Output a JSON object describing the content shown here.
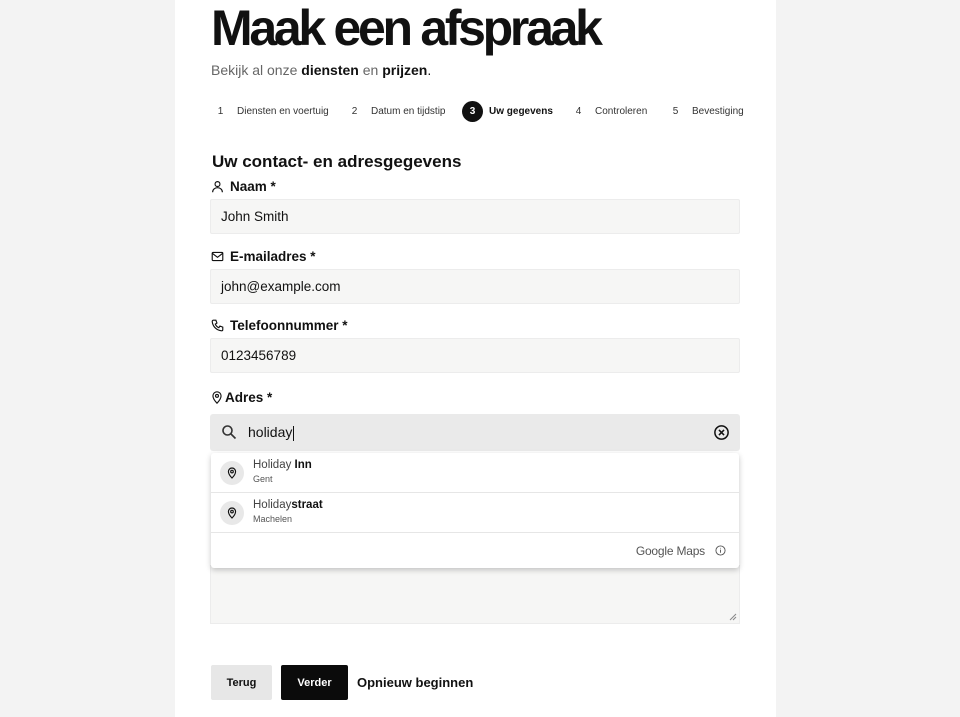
{
  "page": {
    "title": "Maak een afspraak",
    "subtitle": {
      "prefix": "Bekijk al onze",
      "link_services": "diensten",
      "middle": "en",
      "link_prices": "prijzen",
      "suffix": "."
    }
  },
  "steps": [
    {
      "num": "1",
      "label": "Diensten en voertuig"
    },
    {
      "num": "2",
      "label": "Datum en tijdstip"
    },
    {
      "num": "3",
      "label": "Uw gegevens",
      "active": true
    },
    {
      "num": "4",
      "label": "Controleren"
    },
    {
      "num": "5",
      "label": "Bevestiging"
    }
  ],
  "form": {
    "section_title": "Uw contact- en adresgegevens",
    "name": {
      "label": "Naam *",
      "value": "John Smith",
      "icon": "user-icon"
    },
    "email": {
      "label": "E-mailadres *",
      "value": "john@example.com",
      "icon": "mail-icon"
    },
    "phone": {
      "label": "Telefoonnummer *",
      "value": "0123456789",
      "icon": "phone-icon"
    },
    "address": {
      "label": "Adres *",
      "search_value": "holiday",
      "icon": "map-pin-icon"
    }
  },
  "suggestions": [
    {
      "match": "Holiday",
      "rest": " Inn",
      "secondary": "Gent"
    },
    {
      "match": "Holiday",
      "rest": "straat",
      "secondary": "Machelen"
    }
  ],
  "attribution": "Google Maps",
  "buttons": {
    "back": "Terug",
    "next": "Verder",
    "restart": "Opnieuw beginnen"
  }
}
